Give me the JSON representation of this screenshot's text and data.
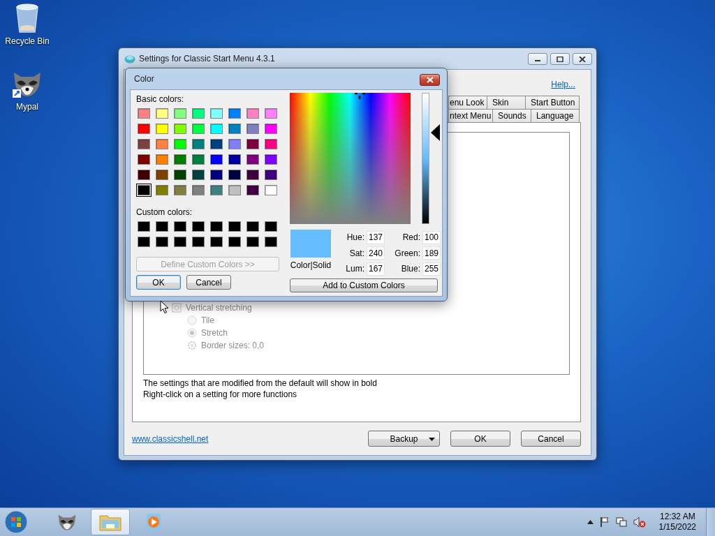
{
  "desktop_icons": [
    {
      "kind": "bin",
      "label": "Recycle Bin"
    },
    {
      "kind": "raccoon",
      "label": "Mypal"
    }
  ],
  "settings_window": {
    "title": "Settings for Classic Start Menu 4.3.1",
    "help_link": "Help...",
    "tab_rows": [
      [
        {
          "label": "enu Look",
          "selected": false
        },
        {
          "label": "Skin",
          "selected": false
        },
        {
          "label": "Start Button",
          "selected": false
        }
      ],
      [
        {
          "label": "ntext Menu",
          "selected": false
        },
        {
          "label": "Sounds",
          "selected": false
        },
        {
          "label": "Language",
          "selected": false
        }
      ]
    ],
    "settings": [
      {
        "kind": "checkbox",
        "label": "Vertical stretching",
        "disabled": true,
        "children": [
          {
            "kind": "radio",
            "label": "Tile",
            "selected": false,
            "disabled": true
          },
          {
            "kind": "radio",
            "label": "Stretch",
            "selected": true,
            "disabled": true
          },
          {
            "kind": "setting",
            "label": "Border sizes: 0,0",
            "disabled": true
          }
        ]
      }
    ],
    "notes": [
      "The settings that are modified from the default will show in bold",
      "Right-click on a setting for more functions"
    ],
    "website_link": "www.classicshell.net",
    "buttons": [
      {
        "kind": "dropdown",
        "label": "Backup"
      },
      {
        "kind": "plain",
        "label": "OK"
      },
      {
        "kind": "plain",
        "label": "Cancel"
      }
    ]
  },
  "color_dialog": {
    "title": "Color",
    "basic_label": "Basic colors:",
    "basic_colors": [
      {
        "color": "#ff8080",
        "selected": false
      },
      {
        "color": "#ffff80",
        "selected": false
      },
      {
        "color": "#80ff80",
        "selected": false
      },
      {
        "color": "#00ff80",
        "selected": false
      },
      {
        "color": "#80ffff",
        "selected": false
      },
      {
        "color": "#0080ff",
        "selected": false
      },
      {
        "color": "#ff80c0",
        "selected": false
      },
      {
        "color": "#ff80ff",
        "selected": false
      },
      {
        "color": "#ff0000",
        "selected": false
      },
      {
        "color": "#ffff00",
        "selected": false
      },
      {
        "color": "#80ff00",
        "selected": false
      },
      {
        "color": "#00ff40",
        "selected": false
      },
      {
        "color": "#00ffff",
        "selected": false
      },
      {
        "color": "#0080c0",
        "selected": false
      },
      {
        "color": "#8080c0",
        "selected": false
      },
      {
        "color": "#ff00ff",
        "selected": false
      },
      {
        "color": "#804040",
        "selected": false
      },
      {
        "color": "#ff8040",
        "selected": false
      },
      {
        "color": "#00ff00",
        "selected": false
      },
      {
        "color": "#008080",
        "selected": false
      },
      {
        "color": "#004080",
        "selected": false
      },
      {
        "color": "#8080ff",
        "selected": false
      },
      {
        "color": "#800040",
        "selected": false
      },
      {
        "color": "#ff0080",
        "selected": false
      },
      {
        "color": "#800000",
        "selected": false
      },
      {
        "color": "#ff8000",
        "selected": false
      },
      {
        "color": "#008000",
        "selected": false
      },
      {
        "color": "#008040",
        "selected": false
      },
      {
        "color": "#0000ff",
        "selected": false
      },
      {
        "color": "#0000a0",
        "selected": false
      },
      {
        "color": "#800080",
        "selected": false
      },
      {
        "color": "#8000ff",
        "selected": false
      },
      {
        "color": "#400000",
        "selected": false
      },
      {
        "color": "#804000",
        "selected": false
      },
      {
        "color": "#004000",
        "selected": false
      },
      {
        "color": "#004040",
        "selected": false
      },
      {
        "color": "#000080",
        "selected": false
      },
      {
        "color": "#000040",
        "selected": false
      },
      {
        "color": "#400040",
        "selected": false
      },
      {
        "color": "#400080",
        "selected": false
      },
      {
        "color": "#000000",
        "selected": true
      },
      {
        "color": "#808000",
        "selected": false
      },
      {
        "color": "#808040",
        "selected": false
      },
      {
        "color": "#808080",
        "selected": false
      },
      {
        "color": "#408080",
        "selected": false
      },
      {
        "color": "#c0c0c0",
        "selected": false
      },
      {
        "color": "#400040",
        "selected": false
      },
      {
        "color": "#ffffff",
        "selected": false
      }
    ],
    "custom_label": "Custom colors:",
    "custom_colors": [
      {
        "color": "#000000"
      },
      {
        "color": "#000000"
      },
      {
        "color": "#000000"
      },
      {
        "color": "#000000"
      },
      {
        "color": "#000000"
      },
      {
        "color": "#000000"
      },
      {
        "color": "#000000"
      },
      {
        "color": "#000000"
      },
      {
        "color": "#000000"
      },
      {
        "color": "#000000"
      },
      {
        "color": "#000000"
      },
      {
        "color": "#000000"
      },
      {
        "color": "#000000"
      },
      {
        "color": "#000000"
      },
      {
        "color": "#000000"
      },
      {
        "color": "#000000"
      }
    ],
    "define_button": {
      "label": "Define Custom Colors >>",
      "disabled": true
    },
    "ok_button": "OK",
    "cancel_button": "Cancel",
    "luminosity": {
      "level": 0.7
    },
    "preview": {
      "color": "#64bdff",
      "label": "Color|Solid"
    },
    "fields_left": [
      {
        "label": "Hue:",
        "value": "137"
      },
      {
        "label": "Sat:",
        "value": "240"
      },
      {
        "label": "Lum:",
        "value": "167"
      }
    ],
    "fields_right": [
      {
        "label": "Red:",
        "value": "100"
      },
      {
        "label": "Green:",
        "value": "189"
      },
      {
        "label": "Blue:",
        "value": "255"
      }
    ],
    "add_button": "Add to Custom Colors"
  },
  "taskbar": {
    "items": [
      {
        "kind": "raccoon",
        "selected": false
      },
      {
        "kind": "folder",
        "selected": true
      },
      {
        "kind": "media",
        "selected": false
      }
    ],
    "time": "12:32 AM",
    "date": "1/15/2022"
  }
}
